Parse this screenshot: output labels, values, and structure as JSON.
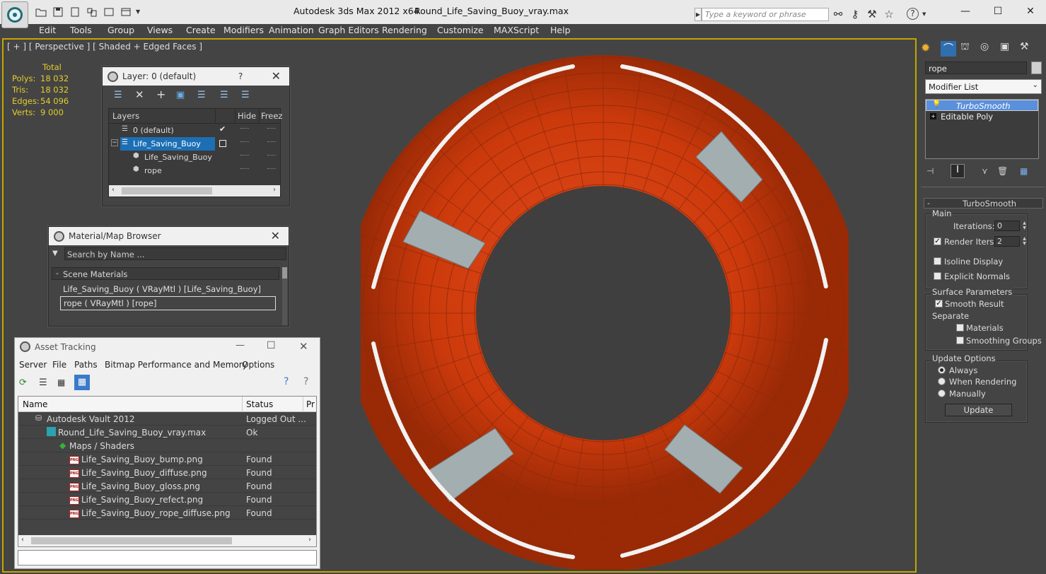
{
  "titlebar": {
    "app_title": "Autodesk 3ds Max  2012 x64",
    "file_title": "Round_Life_Saving_Buoy_vray.max",
    "search_placeholder": "Type a keyword or phrase"
  },
  "menu": [
    "Edit",
    "Tools",
    "Group",
    "Views",
    "Create",
    "Modifiers",
    "Animation",
    "Graph Editors",
    "Rendering",
    "Customize",
    "MAXScript",
    "Help"
  ],
  "viewport": {
    "label": "[ + ] [ Perspective ] [ Shaded + Edged Faces ]",
    "stats": {
      "header": "Total",
      "rows": [
        {
          "label": "Polys:",
          "value": "18 032"
        },
        {
          "label": "Tris:",
          "value": "18 032"
        },
        {
          "label": "Edges:",
          "value": "54 096"
        },
        {
          "label": "Verts:",
          "value": "9 000"
        }
      ]
    },
    "colors": {
      "buoy": "#d43b0f",
      "stripe": "#a3aeb0",
      "rope": "#f2f2f2",
      "background": "#444444"
    }
  },
  "layer_window": {
    "title": "Layer: 0 (default)",
    "help": "?",
    "columns": [
      "Layers",
      "Hide",
      "Freez"
    ],
    "rows": [
      {
        "name": "0 (default)"
      },
      {
        "name": "Life_Saving_Buoy"
      },
      {
        "name": "Life_Saving_Buoy"
      },
      {
        "name": "rope"
      }
    ]
  },
  "material_browser": {
    "title": "Material/Map Browser",
    "search_placeholder": "Search by Name ...",
    "section": "Scene Materials",
    "items": [
      "Life_Saving_Buoy  ( VRayMtl ) [Life_Saving_Buoy]",
      "rope  ( VRayMtl ) [rope]"
    ]
  },
  "asset_tracking": {
    "title": "Asset Tracking",
    "menu": [
      "Server",
      "File",
      "Paths",
      "Bitmap Performance and Memory",
      "Options"
    ],
    "columns": [
      "Name",
      "Status",
      "Pr"
    ],
    "rows": [
      {
        "name": "Autodesk Vault 2012",
        "status": "Logged Out ..."
      },
      {
        "name": "Round_Life_Saving_Buoy_vray.max",
        "status": "Ok"
      },
      {
        "name": "Maps / Shaders",
        "status": ""
      },
      {
        "name": "Life_Saving_Buoy_bump.png",
        "status": "Found"
      },
      {
        "name": "Life_Saving_Buoy_diffuse.png",
        "status": "Found"
      },
      {
        "name": "Life_Saving_Buoy_gloss.png",
        "status": "Found"
      },
      {
        "name": "Life_Saving_Buoy_refect.png",
        "status": "Found"
      },
      {
        "name": "Life_Saving_Buoy_rope_diffuse.png",
        "status": "Found"
      }
    ],
    "png_badge": "PNG"
  },
  "command_panel": {
    "object_name": "rope",
    "modifier_list": "Modifier List",
    "stack": [
      "TurboSmooth",
      "Editable Poly"
    ],
    "stack_expand": "+",
    "rollout_title": "TurboSmooth",
    "rollout_toggle": "-",
    "main_label": "Main",
    "iterations_label": "Iterations:",
    "iterations_value": "0",
    "render_iters_label": "Render Iters:",
    "render_iters_value": "2",
    "isoline_label": "Isoline Display",
    "explicit_normals_label": "Explicit Normals",
    "surface_label": "Surface Parameters",
    "smooth_result_label": "Smooth Result",
    "separate_label": "Separate",
    "materials_label": "Materials",
    "smoothing_groups_label": "Smoothing Groups",
    "update_options_label": "Update Options",
    "always_label": "Always",
    "when_rendering_label": "When Rendering",
    "manually_label": "Manually",
    "update_button": "Update"
  }
}
